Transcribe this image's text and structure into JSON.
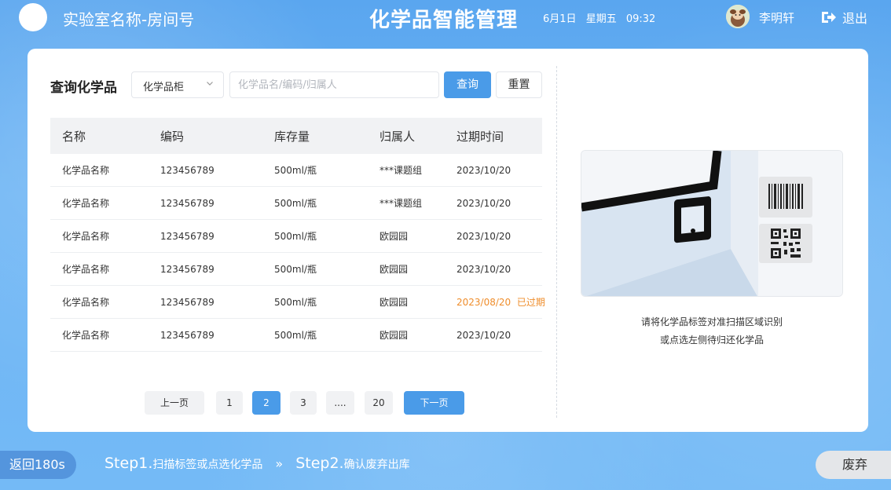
{
  "header": {
    "lab_name": "实验室名称-房间号",
    "title": "化学品智能管理",
    "date": "6月1日",
    "weekday": "星期五",
    "time": "09:32",
    "user": "李明轩",
    "logout_label": "退出"
  },
  "query": {
    "label": "查询化学品",
    "cabinet_select": "化学品柜",
    "search_placeholder": "化学品名/编码/归属人",
    "search_button": "查询",
    "reset_button": "重置"
  },
  "table": {
    "columns": [
      "名称",
      "编码",
      "库存量",
      "归属人",
      "过期时间"
    ],
    "rows": [
      {
        "name": "化学品名称",
        "code": "123456789",
        "stock": "500ml/瓶",
        "owner": "***课题组",
        "expiry": "2023/10/20",
        "status": ""
      },
      {
        "name": "化学品名称",
        "code": "123456789",
        "stock": "500ml/瓶",
        "owner": "***课题组",
        "expiry": "2023/10/20",
        "status": ""
      },
      {
        "name": "化学品名称",
        "code": "123456789",
        "stock": "500ml/瓶",
        "owner": "欧园园",
        "expiry": "2023/10/20",
        "status": ""
      },
      {
        "name": "化学品名称",
        "code": "123456789",
        "stock": "500ml/瓶",
        "owner": "欧园园",
        "expiry": "2023/10/20",
        "status": ""
      },
      {
        "name": "化学品名称",
        "code": "123456789",
        "stock": "500ml/瓶",
        "owner": "欧园园",
        "expiry": "2023/08/20",
        "status": "已过期"
      },
      {
        "name": "化学品名称",
        "code": "123456789",
        "stock": "500ml/瓶",
        "owner": "欧园园",
        "expiry": "2023/10/20",
        "status": ""
      }
    ]
  },
  "pagination": {
    "prev": "上一页",
    "pages": [
      "1",
      "2",
      "3",
      "....",
      "20"
    ],
    "current": "2",
    "next": "下一页"
  },
  "scanner": {
    "hint_line1": "请将化学品标签对准扫描区域识别",
    "hint_line2": "或点选左侧待归还化学品"
  },
  "footer": {
    "back_label": "返回180s",
    "step1_num": "Step1.",
    "step1_text": "扫描标签或点选化学品",
    "separator": "»",
    "step2_num": "Step2.",
    "step2_text": "确认废弃出库",
    "discard_label": "废弃"
  },
  "colors": {
    "accent": "#4a9be8",
    "expired": "#ef8d2b",
    "background": "#6cb4f4"
  }
}
